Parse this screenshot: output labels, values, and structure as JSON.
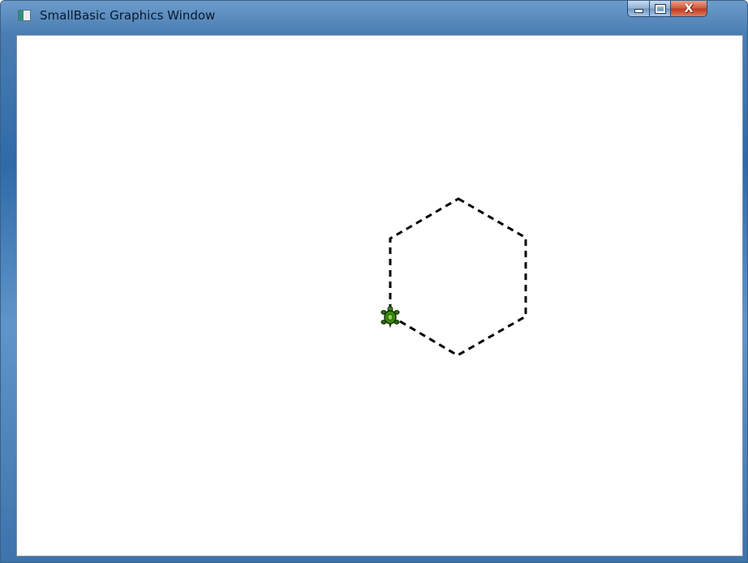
{
  "window": {
    "title": "SmallBasic Graphics Window",
    "icon": "smallbasic-app-icon",
    "controls": {
      "minimize": "minimize-icon",
      "maximize": "maximize-icon",
      "close_glyph": "X"
    }
  },
  "canvas": {
    "background": "#ffffff",
    "shape": "hexagon",
    "line_style": "dashed",
    "line_color": "#000000",
    "turtle": {
      "icon": "turtle-icon",
      "shell_color": "#3c8a12"
    }
  }
}
